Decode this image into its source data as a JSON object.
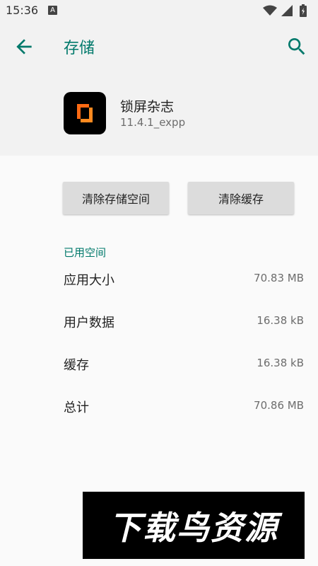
{
  "status_bar": {
    "time": "15:36",
    "notification_letter": "A",
    "icons": [
      "wifi-icon",
      "signal-icon",
      "battery-icon"
    ]
  },
  "header": {
    "title": "存储",
    "back_icon": "arrow-left-icon",
    "search_icon": "search-icon"
  },
  "app": {
    "name": "锁屏杂志",
    "version": "11.4.1_expp"
  },
  "actions": {
    "clear_storage": "清除存储空间",
    "clear_cache": "清除缓存"
  },
  "storage": {
    "section_title": "已用空间",
    "rows": [
      {
        "label": "应用大小",
        "value": "70.83 MB"
      },
      {
        "label": "用户数据",
        "value": "16.38 kB"
      },
      {
        "label": "缓存",
        "value": "16.38 kB"
      },
      {
        "label": "总计",
        "value": "70.86 MB"
      }
    ]
  },
  "watermark": {
    "text": "下载鸟资源"
  },
  "colors": {
    "accent": "#00796b",
    "header_bg": "#f2f2f2",
    "page_bg": "#fafafa",
    "button_bg": "#dcdcdc",
    "app_icon_orange": "#ff6a13"
  }
}
